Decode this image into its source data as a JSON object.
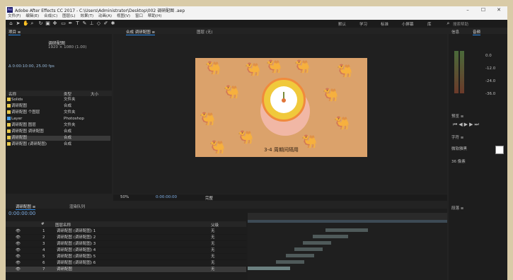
{
  "window": {
    "title": "Adobe After Effects CC 2017 - C:\\Users\\Administrator\\Desktop\\002 调研配图 .aep",
    "min": "–",
    "max": "☐",
    "close": "✕"
  },
  "menu": [
    "文件(F)",
    "编辑(E)",
    "合成(C)",
    "图层(L)",
    "效果(T)",
    "动画(A)",
    "视图(V)",
    "窗口",
    "帮助(H)"
  ],
  "toolbar": {
    "workspace_labels": [
      "默认",
      "学习",
      "标准",
      "小屏幕",
      "库"
    ],
    "search_placeholder": "搜索帮助"
  },
  "project": {
    "tab": "项目 ≡",
    "preview_name": "调研配图",
    "preview_info": "1920 × 1080 (1.00)",
    "preview_info2": "Δ 0:00:10:00, 25.00 fps",
    "columns": [
      "名称",
      "类型",
      "大小"
    ],
    "items": [
      {
        "name": "Solids",
        "type": "文件夹",
        "color": "#e8c94a"
      },
      {
        "name": "调研配图",
        "type": "合成",
        "color": "#e8c94a"
      },
      {
        "name": "调研配图 个图层",
        "type": "文件夹",
        "color": "#e8c94a"
      },
      {
        "name": "Layer",
        "type": "Photoshop",
        "color": "#4aa0e8"
      },
      {
        "name": "调研配图 图层",
        "type": "文件夹",
        "color": "#e8c94a"
      },
      {
        "name": "调研配图 调研配图",
        "type": "合成",
        "color": "#e8c94a"
      },
      {
        "name": "调研配图",
        "type": "合成",
        "color": "#e8c94a"
      },
      {
        "name": "调研配图 (调研配图)",
        "type": "合成",
        "color": "#e8c94a"
      }
    ]
  },
  "viewer": {
    "tabs": [
      "合成 调研配图 ≡",
      "图层 (无)"
    ],
    "caption": "3-4 周期间隔用",
    "zoom": "50%",
    "timecode_bottom": "0:00:00:00",
    "resolution": "完整"
  },
  "timeline": {
    "tabs": [
      "调研配图 ≡",
      "渲染队列"
    ],
    "timecode": "0:00:00:00",
    "columns": [
      "#",
      "图层名称",
      "父级"
    ],
    "layers": [
      {
        "num": "1",
        "name": "调研配图 (调研配图) 1"
      },
      {
        "num": "2",
        "name": "调研配图 (调研配图) 2"
      },
      {
        "num": "3",
        "name": "调研配图 (调研配图) 3"
      },
      {
        "num": "4",
        "name": "调研配图 (调研配图) 4"
      },
      {
        "num": "5",
        "name": "调研配图 (调研配图) 5"
      },
      {
        "num": "6",
        "name": "调研配图 (调研配图) 6"
      },
      {
        "num": "7",
        "name": "调研配图"
      }
    ],
    "parent_none": "无"
  },
  "right": {
    "tabs": [
      "信息",
      "音频"
    ],
    "audio_db": [
      "0.0",
      "-12.0",
      "-24.0",
      "-36.0"
    ],
    "preview_tab": "预览 ≡",
    "char_tab": "字符 ≡",
    "char_font": "微软雅黑",
    "char_size": "36 像素",
    "para_tab": "段落 ≡"
  },
  "colors": {
    "accent": "#2d8ceb",
    "comp_bg": "#dba26b",
    "camel": "#c98c57"
  }
}
